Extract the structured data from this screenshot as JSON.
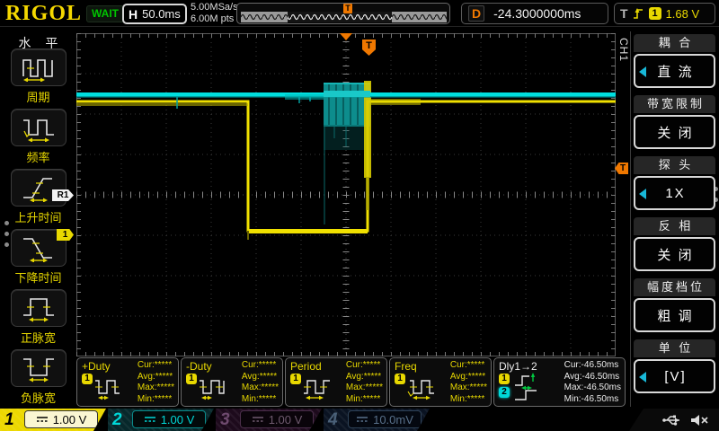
{
  "brand": "RIGOL",
  "top": {
    "status": "WAIT",
    "h_label": "H",
    "timebase": "50.0ms",
    "sample_rate": "5.00MSa/s",
    "memory_depth": "6.00M pts",
    "delay_label": "D",
    "delay_value": "-24.3000000ms",
    "trig_label": "T",
    "trig_source": "1",
    "trig_level": "1.68 V",
    "delay_bar_marker": "T"
  },
  "left_menu": {
    "title": "水 平",
    "items": [
      {
        "label": "周期"
      },
      {
        "label": "频率"
      },
      {
        "label": "上升时间"
      },
      {
        "label": "下降时间"
      },
      {
        "label": "正脉宽"
      },
      {
        "label": "负脉宽"
      }
    ]
  },
  "right_menu": {
    "channel_tab": "CH1",
    "items": [
      {
        "label": "耦 合",
        "value": "直 流",
        "has_arrow": true
      },
      {
        "label": "带宽限制",
        "value": "关 闭",
        "has_arrow": false
      },
      {
        "label": "探 头",
        "value": "1X",
        "has_arrow": true
      },
      {
        "label": "反 相",
        "value": "关 闭",
        "has_arrow": false
      },
      {
        "label": "幅度档位",
        "value": "粗 调",
        "has_arrow": false
      },
      {
        "label": "单 位",
        "value": "[V]",
        "has_arrow": true
      }
    ]
  },
  "stat_labels": {
    "cur": "Cur:",
    "avg": "Avg:",
    "max": "Max:",
    "min": "Min:"
  },
  "measurements": [
    {
      "name": "+Duty",
      "source": "1",
      "cur": "*****",
      "avg": "*****",
      "max": "*****",
      "min": "*****"
    },
    {
      "name": "-Duty",
      "source": "1",
      "cur": "*****",
      "avg": "*****",
      "max": "*****",
      "min": "*****"
    },
    {
      "name": "Period",
      "source": "1",
      "cur": "*****",
      "avg": "*****",
      "max": "*****",
      "min": "*****"
    },
    {
      "name": "Freq",
      "source": "1",
      "cur": "*****",
      "avg": "*****",
      "max": "*****",
      "min": "*****"
    },
    {
      "name": "Dly1→2",
      "source_a": "1",
      "source_b": "2",
      "cur": "-46.50ms",
      "avg": "-46.50ms",
      "max": "-46.50ms",
      "min": "-46.50ms"
    }
  ],
  "channels": [
    {
      "number": "1",
      "scale": "1.00 V",
      "active": true
    },
    {
      "number": "2",
      "scale": "1.00 V",
      "active": false
    },
    {
      "number": "3",
      "scale": "1.00 V",
      "active": false
    },
    {
      "number": "4",
      "scale": "10.0mV",
      "active": false
    }
  ],
  "markers": {
    "reference": "R1",
    "channel1": "1",
    "trigger_level": "T",
    "trigger_position": "T"
  },
  "colors": {
    "ch1": "#f0e000",
    "ch2": "#00e0e0",
    "trigger": "#f07800",
    "wait_green": "#00c400",
    "logo_yellow": "#f5d800"
  }
}
